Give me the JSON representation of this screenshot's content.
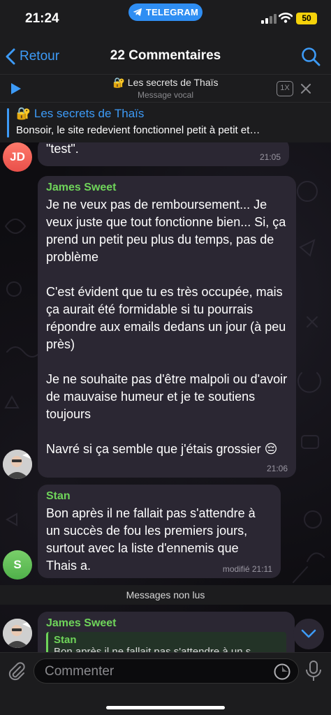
{
  "status_bar": {
    "time": "21:24",
    "app_pill": "TELEGRAM",
    "battery": "50"
  },
  "header": {
    "back_label": "Retour",
    "title": "22 Commentaires"
  },
  "audio": {
    "title": "🔐 Les secrets de Thaïs",
    "subtitle": "Message vocal",
    "speed": "1X"
  },
  "pinned": {
    "title": "🔐 Les secrets de Thaïs",
    "text": "Bonsoir, le site redevient fonctionnel petit à petit et…"
  },
  "messages": [
    {
      "avatar": "JD",
      "text": "\"test\".",
      "time": "21:05"
    },
    {
      "author": "James Sweet",
      "text": "Je ne veux pas de remboursement... Je veux juste que tout fonctionne bien... Si, ça prend un petit peu plus du temps, pas de problème\n\nC'est évident que tu es très occupée, mais ça aurait été formidable si tu pourrais répondre aux emails dedans un jour (à peu près)\n\nJe ne souhaite pas d'être malpoli ou d'avoir de mauvaise humeur et je te soutiens toujours\n\nNavré si ça semble que j'étais grossier 😔",
      "time": "21:06"
    },
    {
      "author": "Stan",
      "avatar": "S",
      "text": "Bon après il ne fallait pas s'attendre à un succès de fou les premiers jours, surtout avec la liste d'ennemis que Thais a.",
      "time": "modifié 21:11"
    },
    {
      "author": "James Sweet",
      "reply": {
        "name": "Stan",
        "text": "Bon après il ne fallait pas s'attendre à un s"
      }
    }
  ],
  "unread_separator": "Messages non lus",
  "input": {
    "placeholder": "Commenter"
  },
  "colors": {
    "accent": "#3d9bf7",
    "author_green": "#6fd45a",
    "bubble": "#2b2733",
    "battery": "#f5d20a"
  }
}
